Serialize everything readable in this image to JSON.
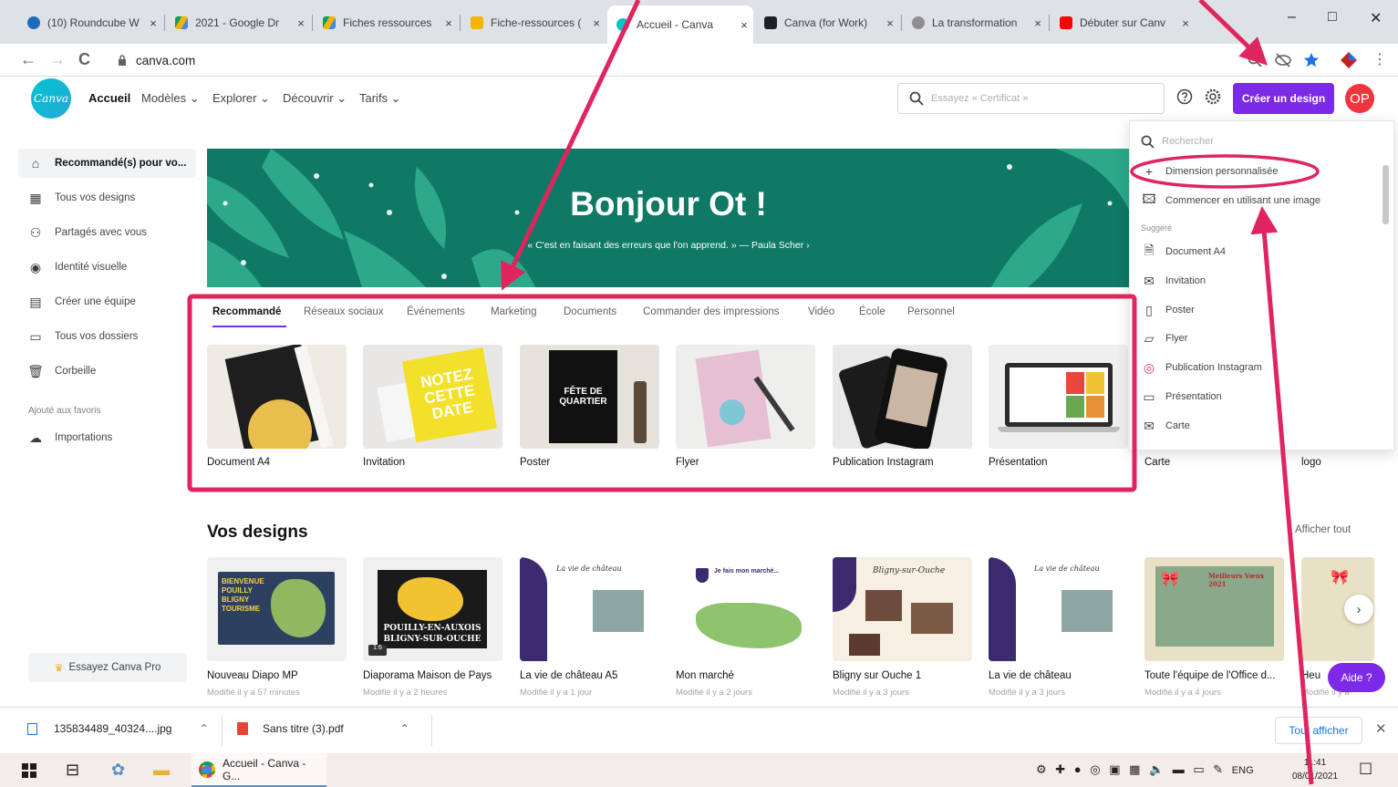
{
  "browser": {
    "tabs": [
      {
        "title": "(10) Roundcube W",
        "color": "#1e6bb8"
      },
      {
        "title": "2021 - Google Dr",
        "color": "#f4b400"
      },
      {
        "title": "Fiches ressources",
        "color": "#0f9d58"
      },
      {
        "title": "Fiche-ressources (",
        "color": "#f4b400"
      },
      {
        "title": "Accueil - Canva",
        "color": "#00c4cc"
      },
      {
        "title": "Canva (for Work)",
        "color": "#202124"
      },
      {
        "title": "La transformation",
        "color": "#8e8e8e"
      },
      {
        "title": "Débuter sur Canv",
        "color": "#ff0000"
      }
    ],
    "close_glyph": "×",
    "win_min": "–",
    "win_max": "□",
    "win_close": "✕",
    "back_glyph": "←",
    "forward_glyph": "→",
    "reload_glyph": "C",
    "url": "canva.com",
    "menu_glyph": "⋮"
  },
  "header": {
    "logo_text": "Canva",
    "nav": [
      "Accueil",
      "Modèles ⌄",
      "Explorer ⌄",
      "Découvrir ⌄",
      "Tarifs ⌄"
    ],
    "search_placeholder": "Essayez « Certificat »",
    "create_label": "Créer un design",
    "avatar_initials": "OP"
  },
  "sidebar": {
    "items": [
      {
        "label": "Recommandé(s) pour vo...",
        "icon": "home-icon"
      },
      {
        "label": "Tous vos designs",
        "icon": "grid-icon"
      },
      {
        "label": "Partagés avec vous",
        "icon": "people-icon"
      },
      {
        "label": "Identité visuelle",
        "icon": "brand-icon"
      },
      {
        "label": "Créer une équipe",
        "icon": "team-icon"
      },
      {
        "label": "Tous vos dossiers",
        "icon": "folder-icon"
      },
      {
        "label": "Corbeille",
        "icon": "trash-icon"
      }
    ],
    "favorites_label": "Ajouté aux favoris",
    "imports_label": "Importations",
    "pro_label": "Essayez Canva Pro"
  },
  "banner": {
    "greeting": "Bonjour Ot !",
    "quote": "« C'est en faisant des erreurs que l'on apprend. » — Paula Scher ›",
    "color": "#0f7965"
  },
  "categories": [
    "Recommandé",
    "Réseaux sociaux",
    "Événements",
    "Marketing",
    "Documents",
    "Commander des impressions",
    "Vidéo",
    "École",
    "Personnel"
  ],
  "templates": [
    {
      "label": "Document A4"
    },
    {
      "label": "Invitation",
      "art": "NOTEZ CETTE DATE"
    },
    {
      "label": "Poster",
      "art": "FÊTE DE QUARTIER"
    },
    {
      "label": "Flyer"
    },
    {
      "label": "Publication Instagram"
    },
    {
      "label": "Présentation"
    }
  ],
  "cut_labels": [
    "Carte",
    "logo"
  ],
  "your_designs": {
    "title": "Vos designs",
    "show_all": "Afficher tout",
    "items": [
      {
        "title": "Nouveau Diapo MP",
        "modified": "Modifié il y a 57 minutes",
        "art": "BIENVENUE POUILLY BLIGNY TOURISME"
      },
      {
        "title": "Diaporama Maison de Pays",
        "modified": "Modifié il y a 2 heures",
        "art": "POUILLY-EN-AUXOIS BLIGNY-SUR-OUCHE"
      },
      {
        "title": "La vie de château A5",
        "modified": "Modifié il y a 1 jour",
        "art": "La vie de château"
      },
      {
        "title": "Mon marché",
        "modified": "Modifié il y a 2 jours",
        "art": "Je fais mon marché..."
      },
      {
        "title": "Bligny sur Ouche 1",
        "modified": "Modifié il y a 3 jours",
        "art": "Bligny-sur-Ouche"
      },
      {
        "title": "La vie de château",
        "modified": "Modifié il y a 3 jours",
        "art": "La vie de château"
      },
      {
        "title": "Toute l'équipe de l'Office d...",
        "modified": "Modifié il y a 4 jours",
        "art": "Meilleurs Vœux 2021"
      }
    ],
    "cut_item": {
      "title": "Heu",
      "modified": "Modifié il y a"
    }
  },
  "dropdown": {
    "search_placeholder": "Rechercher",
    "custom_size": "Dimension personnalisée",
    "start_image": "Commencer en utilisant une image",
    "suggested_label": "Suggéré",
    "suggestions": [
      {
        "label": "Document A4",
        "icon": "document-icon"
      },
      {
        "label": "Invitation",
        "icon": "envelope-icon"
      },
      {
        "label": "Poster",
        "icon": "poster-icon"
      },
      {
        "label": "Flyer",
        "icon": "flyer-icon"
      },
      {
        "label": "Publication Instagram",
        "icon": "instagram-icon"
      },
      {
        "label": "Présentation",
        "icon": "presentation-icon"
      },
      {
        "label": "Carte",
        "icon": "card-icon"
      }
    ]
  },
  "help_label": "Aide ?",
  "downloads": {
    "files": [
      {
        "name": "135834489_40324....jpg"
      },
      {
        "name": "Sans titre (3).pdf"
      }
    ],
    "show_all": "Tout afficher"
  },
  "taskbar": {
    "app_title": "Accueil - Canva - G...",
    "lang": "ENG",
    "time": "11:41",
    "date": "08/01/2021"
  },
  "annotations": {
    "color": "#e0245e"
  }
}
